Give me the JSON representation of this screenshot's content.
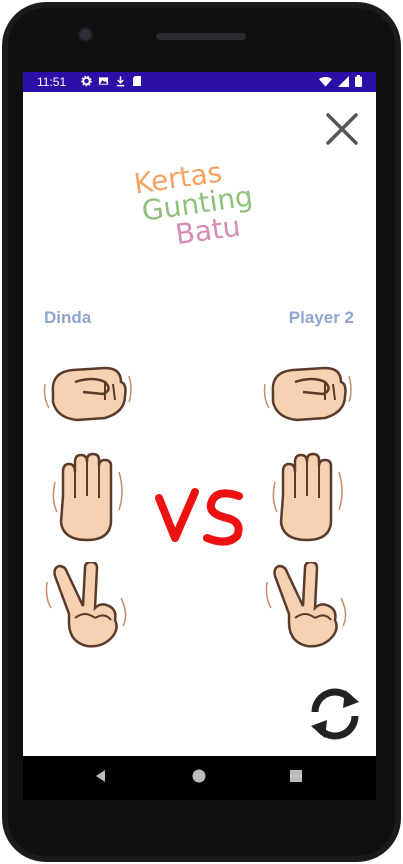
{
  "status_bar": {
    "time": "11:51",
    "left_icons": [
      "gear-icon",
      "image-icon",
      "download-icon",
      "sd-card-icon"
    ],
    "right_icons": [
      "wifi-icon",
      "signal-icon",
      "battery-icon"
    ],
    "background_color": "#2c0fa6"
  },
  "header": {
    "close_icon": "close-icon"
  },
  "title": {
    "line1": "Kertas",
    "line2": "Gunting",
    "line3": "Batu",
    "colors": [
      "#f4a361",
      "#8ec07c",
      "#d88bb4"
    ]
  },
  "players": {
    "player1": "Dinda",
    "player2": "Player 2",
    "name_color": "#8fa4cf"
  },
  "choices": {
    "player1": [
      "rock-hand",
      "paper-hand",
      "scissors-hand"
    ],
    "player2": [
      "rock-hand",
      "paper-hand",
      "scissors-hand"
    ]
  },
  "vs_color": "#ee1111",
  "controls": {
    "refresh_icon": "refresh-icon"
  },
  "navigation": [
    "back-icon",
    "home-icon",
    "recents-icon"
  ]
}
